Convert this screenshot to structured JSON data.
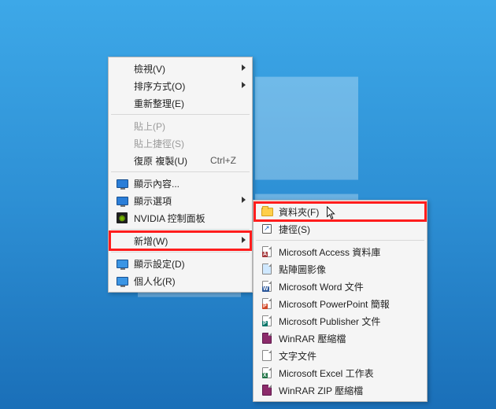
{
  "primary": {
    "view": "檢視(V)",
    "sort": "排序方式(O)",
    "refresh": "重新整理(E)",
    "paste": "貼上(P)",
    "paste_shortcut": "貼上捷徑(S)",
    "undo": "復原 複製(U)",
    "undo_sc": "Ctrl+Z",
    "show_content": "顯示內容...",
    "show_options": "顯示選項",
    "nvidia": "NVIDIA 控制面板",
    "new": "新增(W)",
    "display_settings": "顯示設定(D)",
    "personalize": "個人化(R)"
  },
  "submenu": {
    "folder": "資料夾(F)",
    "shortcut": "捷徑(S)",
    "access": "Microsoft Access 資料庫",
    "bmp": "點陣圖影像",
    "word": "Microsoft Word 文件",
    "ppt": "Microsoft PowerPoint 簡報",
    "pub": "Microsoft Publisher 文件",
    "rar": "WinRAR 壓縮檔",
    "txt": "文字文件",
    "xls": "Microsoft Excel 工作表",
    "zip": "WinRAR ZIP 壓縮檔"
  }
}
